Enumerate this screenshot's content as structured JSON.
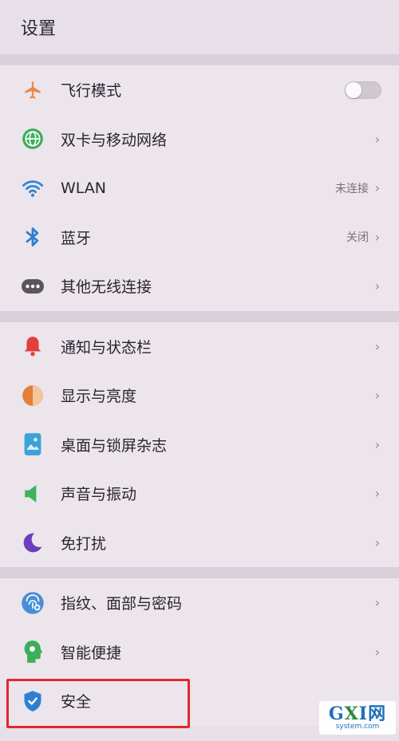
{
  "header": {
    "title": "设置"
  },
  "groups": [
    {
      "items": [
        {
          "label": "飞行模式",
          "icon": "airplane-icon",
          "control": "toggle",
          "toggle_on": false
        },
        {
          "label": "双卡与移动网络",
          "icon": "globe-icon",
          "chevron": "›"
        },
        {
          "label": "WLAN",
          "icon": "wifi-icon",
          "value": "未连接",
          "chevron": "›"
        },
        {
          "label": "蓝牙",
          "icon": "bluetooth-icon",
          "value": "关闭",
          "chevron": "›"
        },
        {
          "label": "其他无线连接",
          "icon": "more-dots-icon",
          "chevron": "›"
        }
      ]
    },
    {
      "items": [
        {
          "label": "通知与状态栏",
          "icon": "bell-icon",
          "chevron": "›"
        },
        {
          "label": "显示与亮度",
          "icon": "brightness-icon",
          "chevron": "›"
        },
        {
          "label": "桌面与锁屏杂志",
          "icon": "wallpaper-icon",
          "chevron": "›"
        },
        {
          "label": "声音与振动",
          "icon": "speaker-icon",
          "chevron": "›"
        },
        {
          "label": "免打扰",
          "icon": "moon-icon",
          "chevron": "›"
        }
      ]
    },
    {
      "items": [
        {
          "label": "指纹、面部与密码",
          "icon": "fingerprint-face-icon",
          "chevron": "›"
        },
        {
          "label": "智能便捷",
          "icon": "smart-head-icon",
          "chevron": "›"
        },
        {
          "label": "安全",
          "icon": "shield-icon"
        }
      ]
    }
  ],
  "colors": {
    "airplane": "#e8894a",
    "globe": "#3cae5c",
    "wifi": "#2f86d6",
    "bluetooth": "#2f7fd0",
    "more": "#5a5460",
    "bell": "#e0413e",
    "brightness": "#e0803a",
    "wallpaper": "#3aa3d8",
    "speaker": "#3cb35a",
    "moon": "#6a3fc0",
    "fingerprint": "#4a8fd6",
    "smart": "#3dae5a",
    "shield": "#2f7fd0",
    "highlight": "#e2282c"
  },
  "watermark": {
    "logo_g": "G",
    "logo_x": "X",
    "logo_i": "I",
    "logo_cn": "网",
    "sub": "system.com"
  }
}
